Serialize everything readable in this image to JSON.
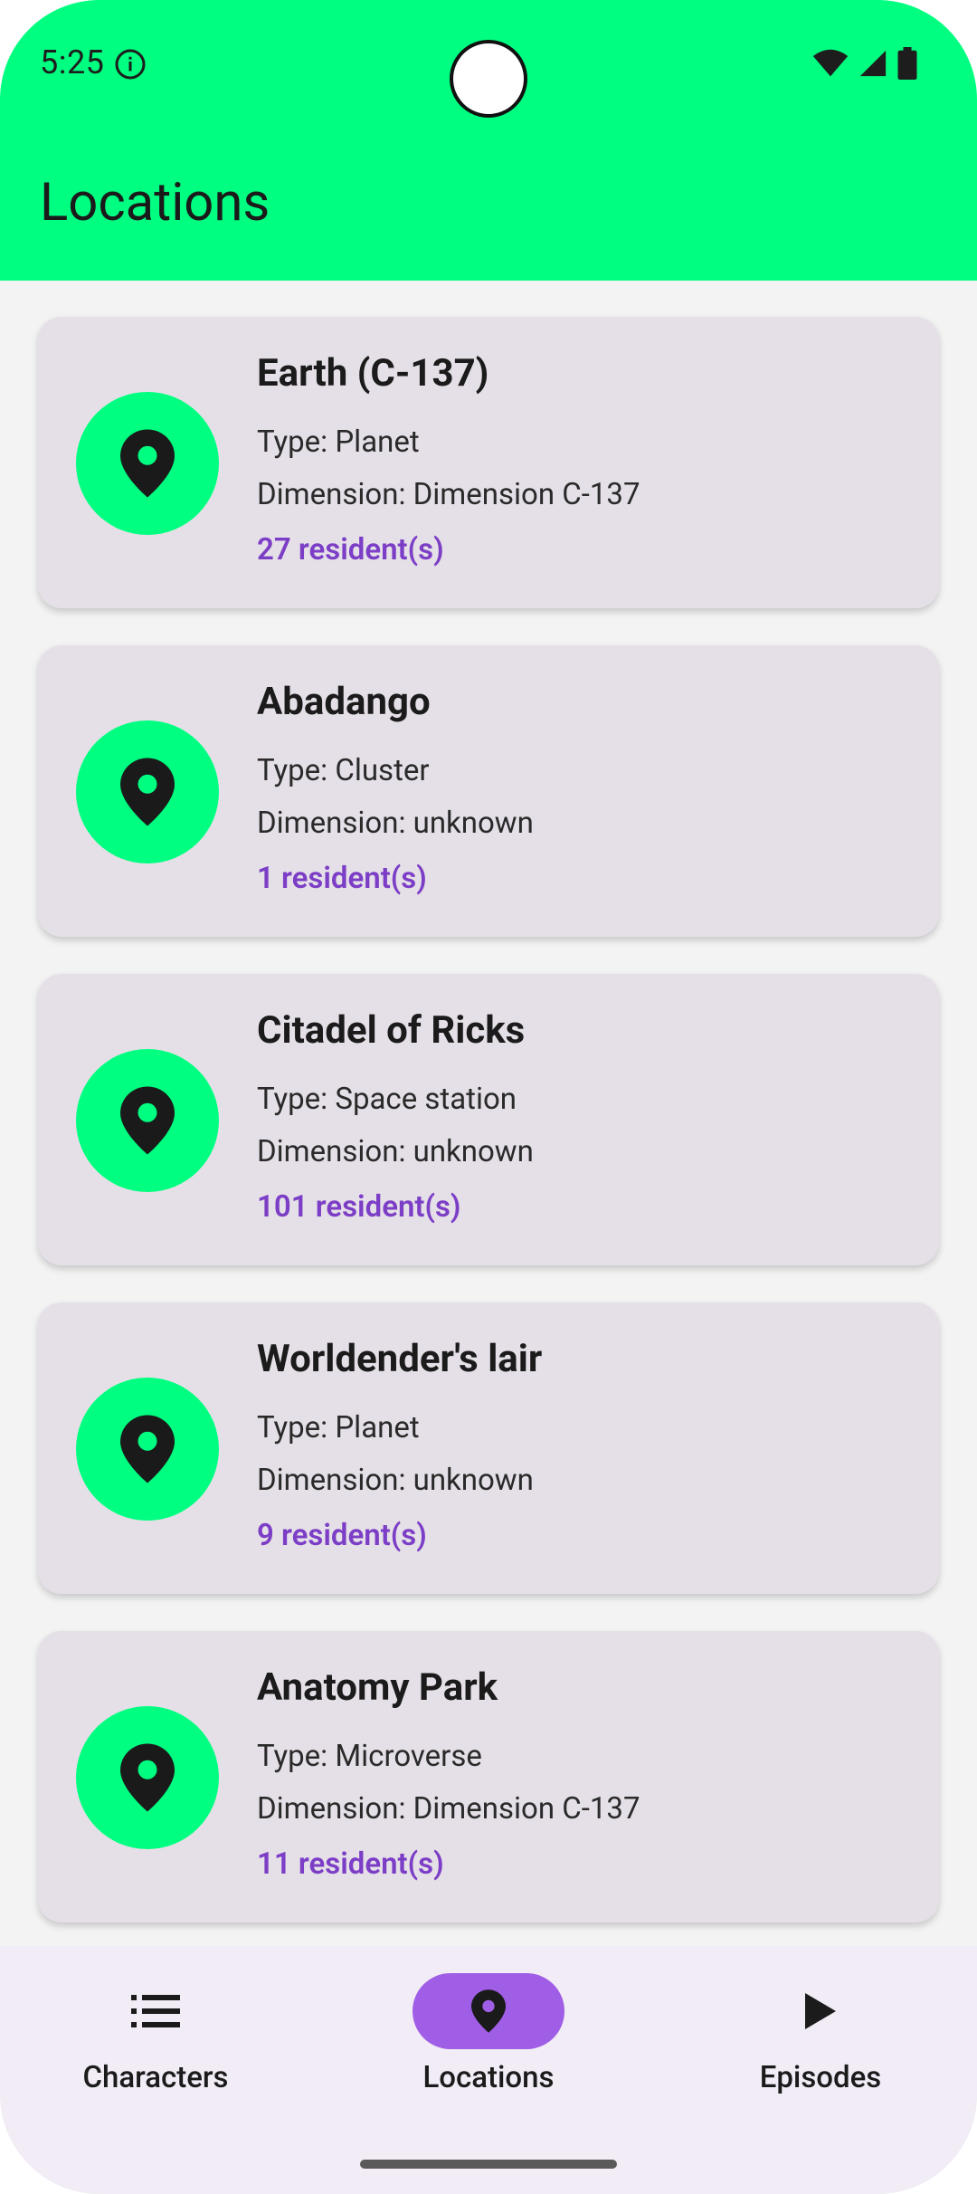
{
  "status": {
    "time": "5:25"
  },
  "app_bar": {
    "title": "Locations"
  },
  "locations": [
    {
      "name": "Earth (C-137)",
      "type": "Type: Planet",
      "dimension": "Dimension: Dimension C-137",
      "residents": "27 resident(s)"
    },
    {
      "name": "Abadango",
      "type": "Type: Cluster",
      "dimension": "Dimension: unknown",
      "residents": "1 resident(s)"
    },
    {
      "name": "Citadel of Ricks",
      "type": "Type: Space station",
      "dimension": "Dimension: unknown",
      "residents": "101 resident(s)"
    },
    {
      "name": "Worldender's lair",
      "type": "Type: Planet",
      "dimension": "Dimension: unknown",
      "residents": "9 resident(s)"
    },
    {
      "name": "Anatomy Park",
      "type": "Type: Microverse",
      "dimension": "Dimension: Dimension C-137",
      "residents": "11 resident(s)"
    }
  ],
  "bottom_nav": {
    "items": [
      {
        "label": "Characters",
        "icon": "list-icon",
        "selected": false
      },
      {
        "label": "Locations",
        "icon": "location-pin-icon",
        "selected": true
      },
      {
        "label": "Episodes",
        "icon": "play-icon",
        "selected": false
      }
    ]
  },
  "colors": {
    "accent": "#00ff80",
    "resident_text": "#7c3ec6",
    "nav_active": "#a05ee6",
    "card_bg": "#e5e0e7"
  }
}
